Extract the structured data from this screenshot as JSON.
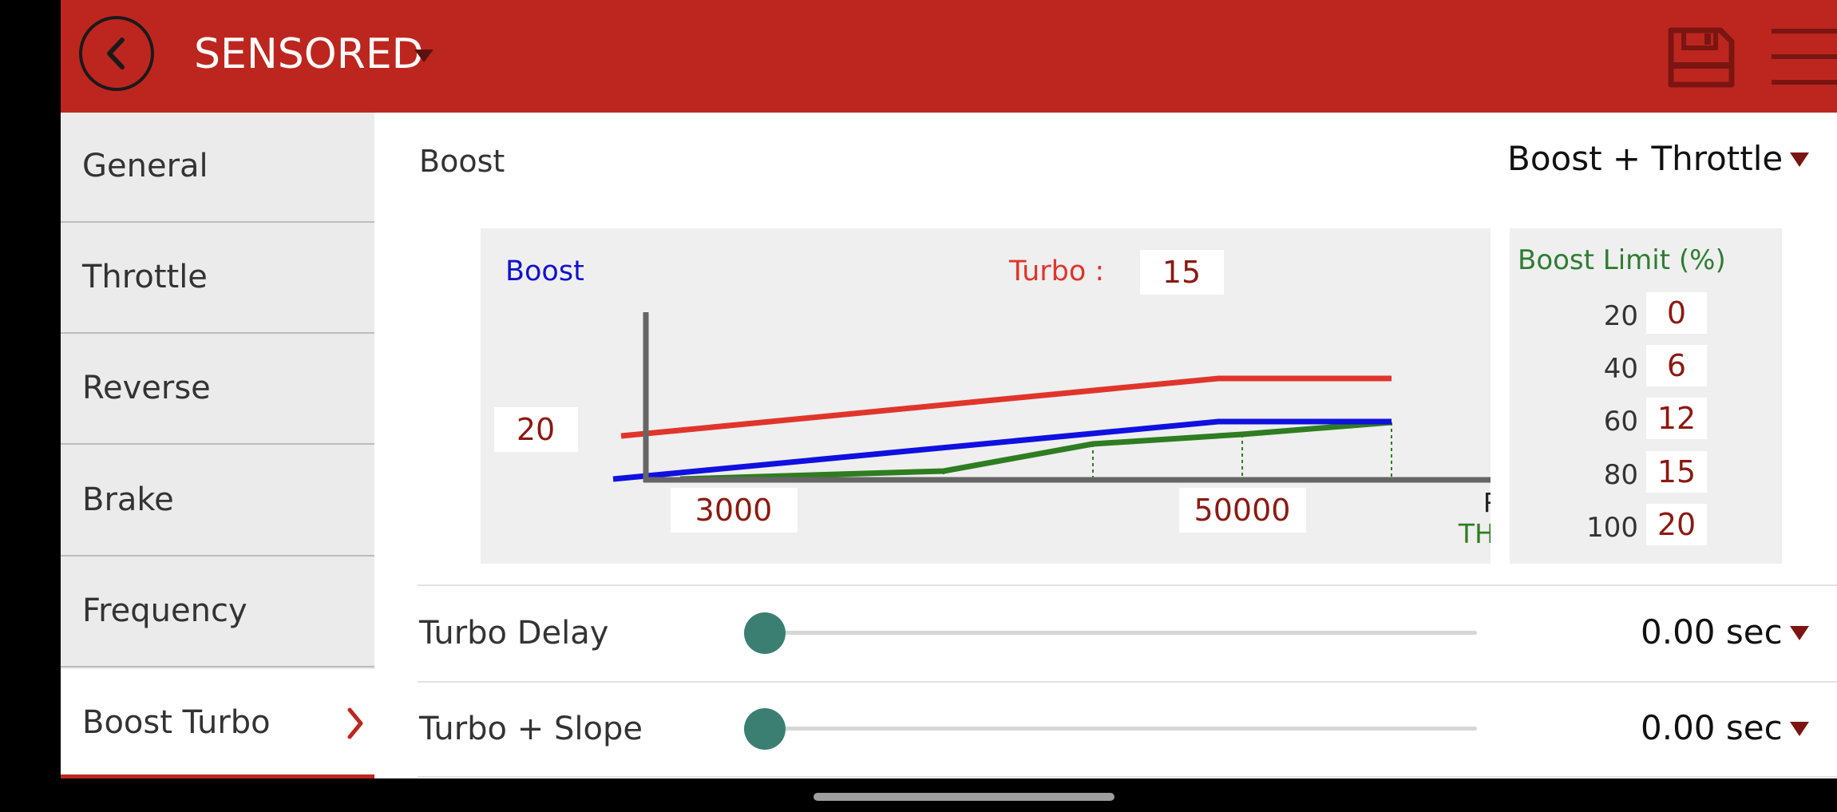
{
  "header": {
    "title": "SENSORED",
    "colors": {
      "bar": "#bd261e"
    },
    "icons": [
      "back-icon",
      "save-icon",
      "menu-icon"
    ]
  },
  "sidebar": {
    "items": [
      {
        "label": "General"
      },
      {
        "label": "Throttle"
      },
      {
        "label": "Reverse"
      },
      {
        "label": "Brake"
      },
      {
        "label": "Frequency"
      },
      {
        "label": "Boost Turbo",
        "active": true
      }
    ]
  },
  "boost": {
    "label": "Boost",
    "mode": "Boost + Throttle"
  },
  "chart_data": {
    "type": "line",
    "ylabel": "Boost",
    "xlabel": "RPM",
    "xlabel2": "TH(%)",
    "turbo_label": "Turbo :",
    "turbo_value": "15",
    "boost_value": "20",
    "rpm_start": "3000",
    "rpm_end": "50000",
    "series": [
      {
        "name": "Turbo",
        "color": "#e0352b"
      },
      {
        "name": "Boost",
        "color": "#1010e0"
      },
      {
        "name": "TH(%)",
        "color": "#2e7d20"
      }
    ]
  },
  "boost_limit": {
    "title": "Boost Limit (%)",
    "rows": [
      {
        "th": "20",
        "value": "0"
      },
      {
        "th": "40",
        "value": "6"
      },
      {
        "th": "60",
        "value": "12"
      },
      {
        "th": "80",
        "value": "15"
      },
      {
        "th": "100",
        "value": "20"
      }
    ]
  },
  "settings": [
    {
      "label": "Turbo Delay",
      "value": "0.00 sec",
      "level": 0
    },
    {
      "label": "Turbo + Slope",
      "value": "0.00 sec",
      "level": 0
    }
  ]
}
